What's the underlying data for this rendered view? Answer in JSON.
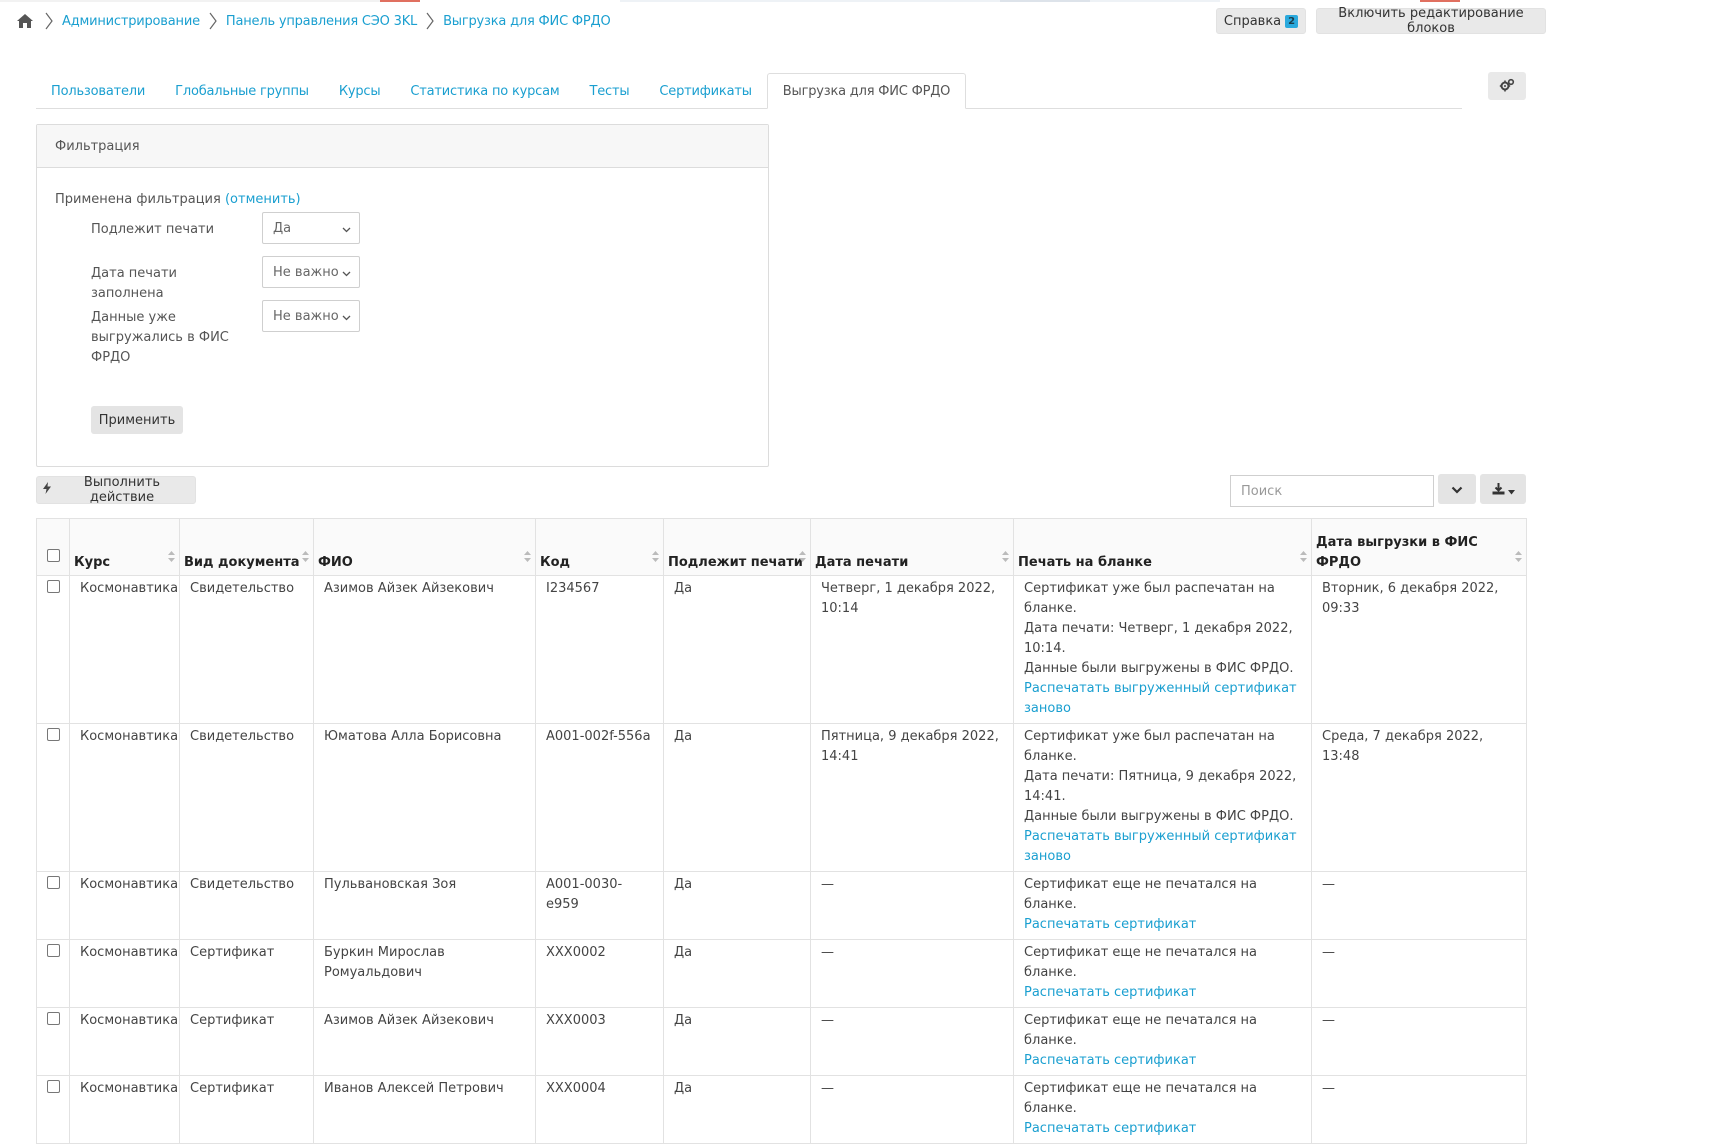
{
  "breadcrumb": {
    "items": [
      "Администрирование",
      "Панель управления СЭО 3KL",
      "Выгрузка для ФИС ФРДО"
    ]
  },
  "header": {
    "help_label": "Справка",
    "help_count": "2",
    "edit_blocks_label": "Включить редактирование блоков"
  },
  "tabs": [
    {
      "label": "Пользователи"
    },
    {
      "label": "Глобальные группы"
    },
    {
      "label": "Курсы"
    },
    {
      "label": "Статистика по курсам"
    },
    {
      "label": "Тесты"
    },
    {
      "label": "Сертификаты"
    },
    {
      "label": "Выгрузка для ФИС ФРДО",
      "active": true
    }
  ],
  "filter": {
    "title": "Фильтрация",
    "applied_text": "Применена фильтрация",
    "cancel_link": "(отменить)",
    "rows": [
      {
        "label": "Подлежит печати",
        "value": "Да"
      },
      {
        "label": "Дата печати заполнена",
        "value": "Не важно"
      },
      {
        "label": "Данные уже выгружались в ФИС ФРДО",
        "value": "Не важно"
      }
    ],
    "apply_label": "Применить"
  },
  "actions": {
    "execute_label": "Выполнить действие",
    "search_placeholder": "Поиск"
  },
  "table": {
    "headers": [
      "Курс",
      "Вид документа",
      "ФИО",
      "Код",
      "Подлежит печати",
      "Дата печати",
      "Печать на бланке",
      "Дата выгрузки в ФИС ФРДО"
    ],
    "rows": [
      {
        "course": "Космонавтика",
        "doc": "Свидетельство",
        "name": "Азимов Айзек Айзекович",
        "code": "I234567",
        "print": "Да",
        "date": "Четверг, 1 декабря 2022, 10:14",
        "status": "Сертификат уже был распечатан на бланке.",
        "status2": "Дата печати: Четверг, 1 декабря 2022, 10:14.",
        "status3": "Данные были выгружены в ФИС ФРДО.",
        "link": "Распечатать выгруженный сертификат заново",
        "export": "Вторник, 6 декабря 2022, 09:33"
      },
      {
        "course": "Космонавтика",
        "doc": "Свидетельство",
        "name": "Юматова Алла Борисовна",
        "code": "A001-002f-556a",
        "print": "Да",
        "date": "Пятница, 9 декабря 2022, 14:41",
        "status": "Сертификат уже был распечатан на бланке.",
        "status2": "Дата печати: Пятница, 9 декабря 2022, 14:41.",
        "status3": "Данные были выгружены в ФИС ФРДО.",
        "link": "Распечатать выгруженный сертификат заново",
        "export": "Среда, 7 декабря 2022, 13:48"
      },
      {
        "course": "Космонавтика",
        "doc": "Свидетельство",
        "name": "Пульвановская Зоя",
        "code": "A001-0030-e959",
        "print": "Да",
        "date": "—",
        "status": "Сертификат еще не печатался на бланке.",
        "link": "Распечатать сертификат",
        "export": "—"
      },
      {
        "course": "Космонавтика",
        "doc": "Сертификат",
        "name": "Буркин Мирослав Ромуальдович",
        "code": "XXX0002",
        "print": "Да",
        "date": "—",
        "status": "Сертификат еще не печатался на бланке.",
        "link": "Распечатать сертификат",
        "export": "—"
      },
      {
        "course": "Космонавтика",
        "doc": "Сертификат",
        "name": "Азимов Айзек Айзекович",
        "code": "XXX0003",
        "print": "Да",
        "date": "—",
        "status": "Сертификат еще не печатался на бланке.",
        "link": "Распечатать сертификат",
        "export": "—"
      },
      {
        "course": "Космонавтика",
        "doc": "Сертификат",
        "name": "Иванов Алексей Петрович",
        "code": "XXX0004",
        "print": "Да",
        "date": "—",
        "status": "Сертификат еще не печатался на бланке.",
        "link": "Распечатать сертификат",
        "export": "—"
      }
    ]
  },
  "colors": {
    "link": "#1a9fd0",
    "badge": "#2aa9dd",
    "border": "#e2e2e2"
  },
  "icons": [
    "home-icon",
    "chevron-right-icon",
    "gears-icon",
    "bolt-icon",
    "chevron-down-icon",
    "download-icon",
    "sort-icon",
    "checkbox-icon"
  ]
}
